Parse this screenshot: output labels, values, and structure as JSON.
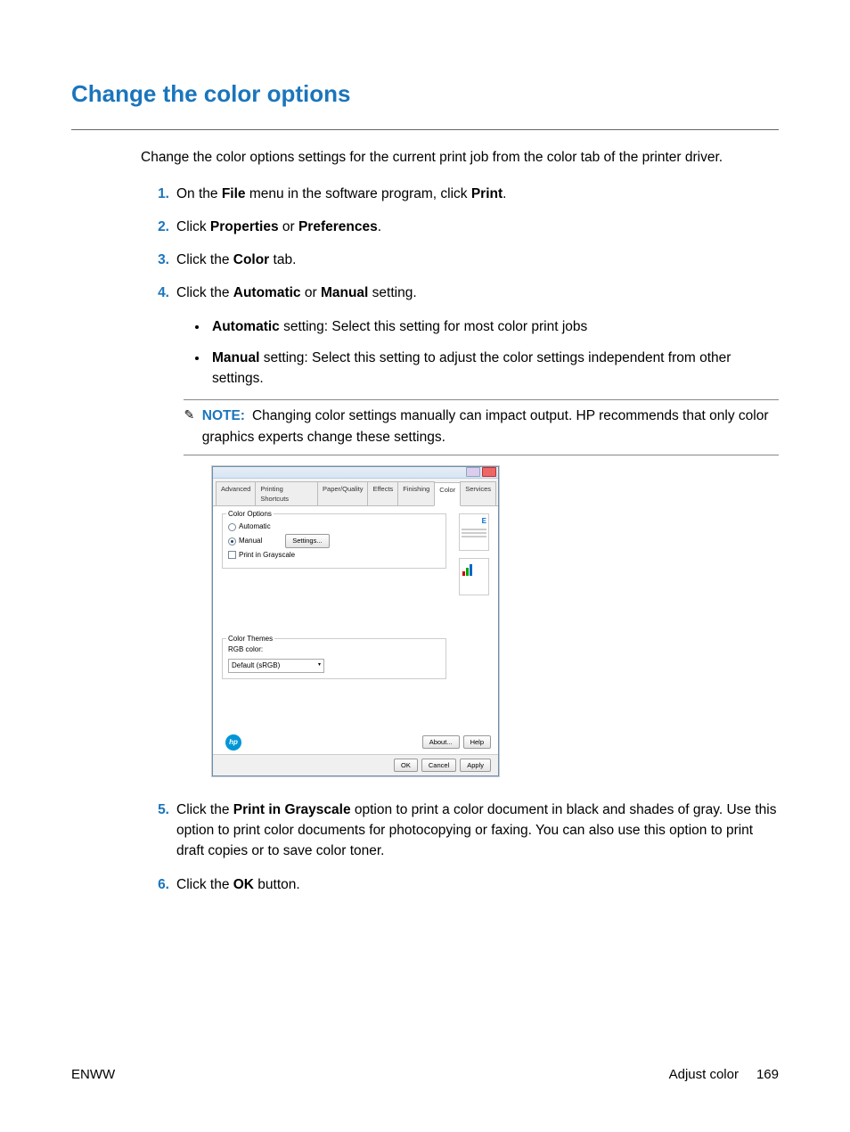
{
  "heading": "Change the color options",
  "intro": "Change the color options settings for the current print job from the color tab of the printer driver.",
  "steps": {
    "s1": {
      "num": "1.",
      "a": "On the ",
      "b": "File",
      "c": " menu in the software program, click ",
      "d": "Print",
      "e": "."
    },
    "s2": {
      "num": "2.",
      "a": "Click ",
      "b": "Properties",
      "c": " or ",
      "d": "Preferences",
      "e": "."
    },
    "s3": {
      "num": "3.",
      "a": "Click the ",
      "b": "Color",
      "c": " tab."
    },
    "s4": {
      "num": "4.",
      "a": "Click the ",
      "b": "Automatic",
      "c": " or ",
      "d": "Manual",
      "e": " setting."
    },
    "s4_sub1": {
      "b": "Automatic",
      "t": " setting: Select this setting for most color print jobs"
    },
    "s4_sub2": {
      "b": "Manual",
      "t": " setting: Select this setting to adjust the color settings independent from other settings."
    },
    "note": {
      "label": "NOTE:",
      "text": "Changing color settings manually can impact output. HP recommends that only color graphics experts change these settings."
    },
    "s5": {
      "num": "5.",
      "a": "Click the ",
      "b": "Print in Grayscale",
      "c": " option to print a color document in black and shades of gray. Use this option to print color documents for photocopying or faxing. You can also use this option to print draft copies or to save color toner."
    },
    "s6": {
      "num": "6.",
      "a": "Click the ",
      "b": "OK",
      "c": " button."
    }
  },
  "dialog": {
    "tabs": [
      "Advanced",
      "Printing Shortcuts",
      "Paper/Quality",
      "Effects",
      "Finishing",
      "Color",
      "Services"
    ],
    "active_tab": "Color",
    "color_options": {
      "title": "Color Options",
      "automatic": "Automatic",
      "manual": "Manual",
      "settings_btn": "Settings...",
      "grayscale": "Print in Grayscale"
    },
    "color_themes": {
      "title": "Color Themes",
      "label": "RGB color:",
      "selected": "Default (sRGB)"
    },
    "buttons": {
      "about": "About...",
      "help": "Help",
      "ok": "OK",
      "cancel": "Cancel",
      "apply": "Apply"
    }
  },
  "footer": {
    "left": "ENWW",
    "right_text": "Adjust color",
    "page": "169"
  }
}
